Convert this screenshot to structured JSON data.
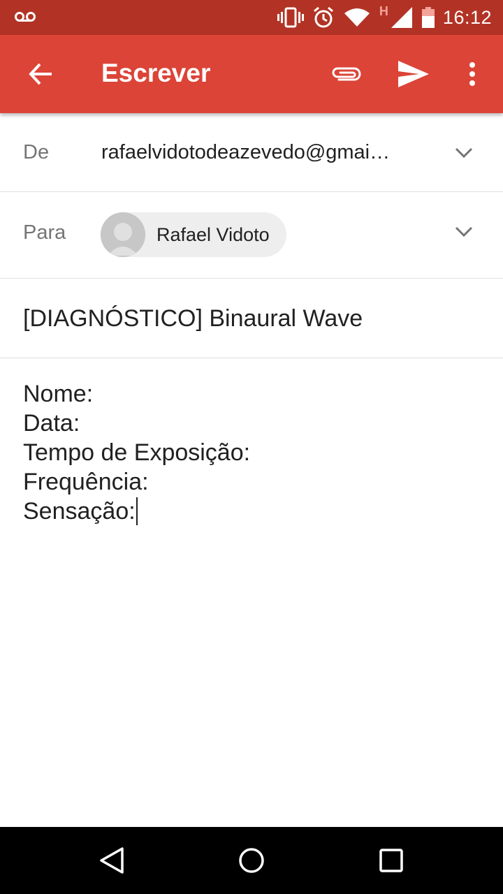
{
  "status_bar": {
    "time": "16:12",
    "network_type": "H",
    "icons": [
      "voicemail-icon",
      "vibrate-icon",
      "alarm-icon",
      "wifi-icon",
      "signal-icon",
      "battery-icon"
    ],
    "background_color": "#b23325"
  },
  "app_bar": {
    "title": "Escrever",
    "background_color": "#db4437",
    "icons": [
      "back-arrow-icon",
      "attach-icon",
      "send-icon",
      "more-vert-icon"
    ]
  },
  "compose": {
    "from": {
      "label": "De",
      "value": "rafaelvidotodeazevedo@gmai…"
    },
    "to": {
      "label": "Para",
      "recipient_name": "Rafael Vidoto"
    },
    "subject": "[DIAGNÓSTICO] Binaural Wave",
    "body_lines": [
      "Nome:",
      "Data:",
      "Tempo de Exposição:",
      "Frequência:",
      "Sensação:"
    ]
  },
  "nav_bar": {
    "icons": [
      "back-triangle-icon",
      "home-circle-icon",
      "recents-square-icon"
    ]
  }
}
